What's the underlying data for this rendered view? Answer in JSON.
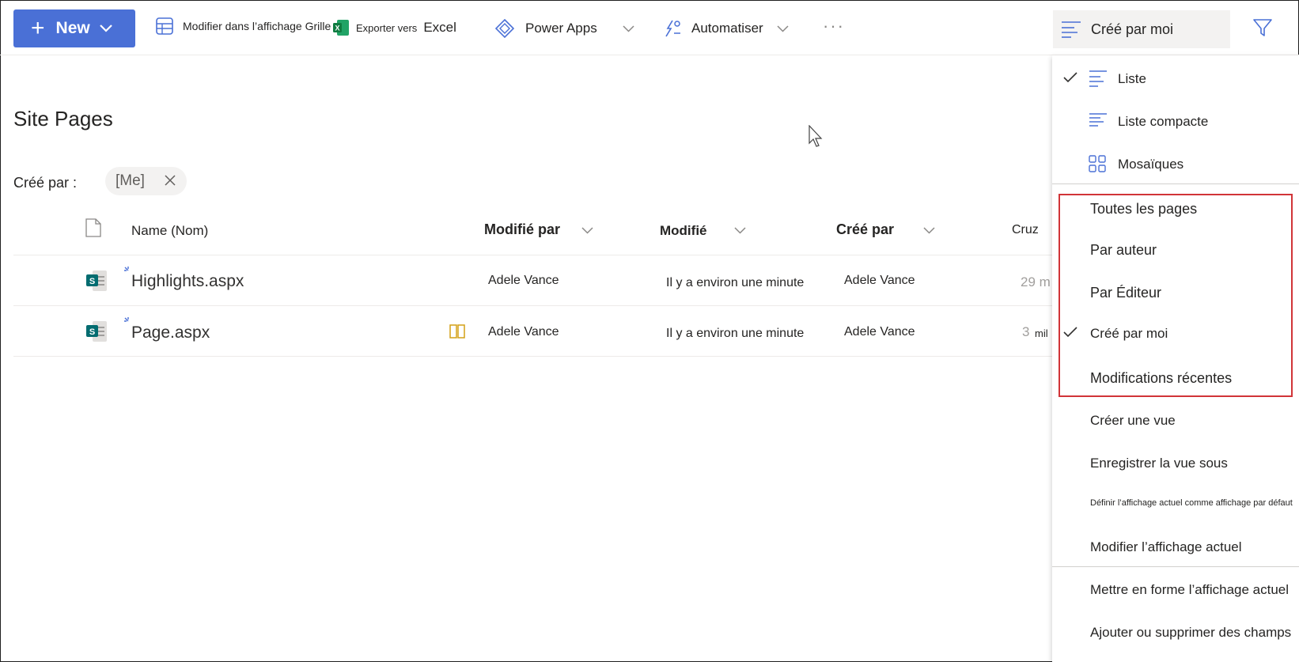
{
  "toolbar": {
    "new_label": "New",
    "grid_label": "Modifier dans l’affichage Grille",
    "export_label_small": "Exporter vers",
    "export_label": "Excel",
    "powerapps_label": "Power Apps",
    "automate_label": "Automatiser",
    "more_label": "···",
    "view_selector_label": "Créé par moi"
  },
  "page": {
    "title": "Site Pages",
    "filter_label": "Créé par :",
    "filter_pill": "[Me]"
  },
  "columns": {
    "name": "Name (Nom)",
    "modified_by": "Modifié par",
    "modified": "Modifié",
    "created_by": "Créé par",
    "extra": "Cruz"
  },
  "rows": [
    {
      "name": "Highlights.aspx",
      "modified_by": "Adele Vance",
      "modified": "Il y a environ une minute",
      "created_by": "Adele Vance",
      "extra": "29 m"
    },
    {
      "name": "Page.aspx",
      "modified_by": "Adele Vance",
      "modified": "Il y a environ une minute",
      "created_by": "Adele Vance",
      "extra": "3",
      "extra2": "mil"
    }
  ],
  "menu": {
    "layout_items": [
      {
        "label": "Liste",
        "checked": true,
        "icon": "list-icon"
      },
      {
        "label": "Liste compacte",
        "checked": false,
        "icon": "compact-list-icon"
      },
      {
        "label": "Mosaïques",
        "checked": false,
        "icon": "tiles-icon"
      }
    ],
    "views": [
      {
        "label": "Toutes les pages",
        "checked": false
      },
      {
        "label": "Par auteur",
        "checked": false
      },
      {
        "label": "Par Éditeur",
        "checked": false
      },
      {
        "label": "Créé par moi",
        "checked": true
      },
      {
        "label": "Modifications récentes",
        "checked": false
      }
    ],
    "actions": {
      "create_view": "Créer une vue",
      "save_view_as": "Enregistrer la vue sous",
      "set_default": "Définir l’affichage actuel comme affichage par défaut",
      "edit_view": "Modifier l’affichage actuel",
      "format_view": "Mettre en forme l’affichage actuel",
      "add_remove_columns": "Ajouter ou supprimer des champs"
    }
  },
  "colors": {
    "accent": "#4a70d6",
    "highlight_border": "#d13438",
    "sharepoint_green": "#036c70"
  }
}
